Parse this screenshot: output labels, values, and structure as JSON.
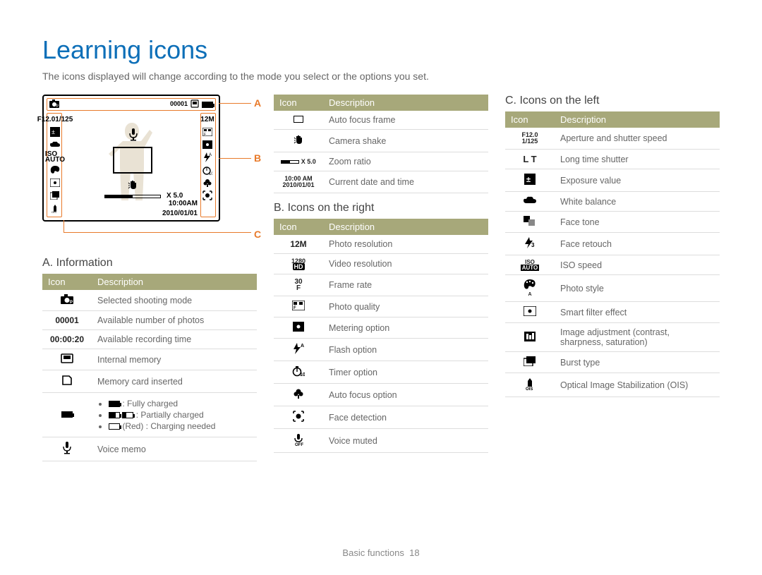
{
  "title": "Learning icons",
  "intro": "The icons displayed will change according to the mode you select or the options you set.",
  "labels": {
    "A": "A",
    "B": "B",
    "C": "C"
  },
  "diagram": {
    "count": "00001",
    "zoom": "X 5.0",
    "time": "10:00AM",
    "date": "2010/01/01",
    "aperture": "F12.0",
    "shutter": "1/125"
  },
  "headers": {
    "icon": "Icon",
    "desc": "Description"
  },
  "sectionA": {
    "title": "A. Information",
    "rows": [
      {
        "icon": "camera",
        "desc": "Selected shooting mode"
      },
      {
        "icon": "00001",
        "desc": "Available number of photos"
      },
      {
        "icon": "00:00:20",
        "desc": "Available recording time"
      },
      {
        "icon": "internal-mem",
        "desc": "Internal memory"
      },
      {
        "icon": "card",
        "desc": "Memory card inserted"
      },
      {
        "icon": "battery",
        "desc_list": [
          ": Fully charged",
          ": Partially charged",
          "(Red) : Charging needed"
        ]
      },
      {
        "icon": "mic",
        "desc": "Voice memo"
      }
    ]
  },
  "sectionTop": {
    "rows": [
      {
        "icon": "frame",
        "desc": "Auto focus frame"
      },
      {
        "icon": "shake",
        "desc": "Camera shake"
      },
      {
        "icon": "zoom",
        "icon_text": "X 5.0",
        "desc": "Zoom ratio"
      },
      {
        "icon": "datetime",
        "icon_text1": "10:00 AM",
        "icon_text2": "2010/01/01",
        "desc": "Current date and time"
      }
    ]
  },
  "sectionB": {
    "title": "B. Icons on the right",
    "rows": [
      {
        "icon": "12M",
        "desc": "Photo resolution"
      },
      {
        "icon": "1280HD",
        "desc": "Video resolution"
      },
      {
        "icon": "30F",
        "desc": "Frame rate"
      },
      {
        "icon": "quality",
        "desc": "Photo quality"
      },
      {
        "icon": "metering",
        "desc": "Metering option"
      },
      {
        "icon": "flashA",
        "desc": "Flash option"
      },
      {
        "icon": "timer10",
        "desc": "Timer option"
      },
      {
        "icon": "flower",
        "desc": "Auto focus option"
      },
      {
        "icon": "facedetect",
        "desc": "Face detection"
      },
      {
        "icon": "micoff",
        "desc": "Voice muted"
      }
    ]
  },
  "sectionC": {
    "title": "C. Icons on the left",
    "rows": [
      {
        "icon": "F12.0 1/125",
        "desc": "Aperture and shutter speed"
      },
      {
        "icon": "LT",
        "desc": "Long time shutter"
      },
      {
        "icon": "ev",
        "desc": "Exposure value"
      },
      {
        "icon": "cloud",
        "desc": "White balance"
      },
      {
        "icon": "facetone",
        "desc": "Face tone"
      },
      {
        "icon": "retouch",
        "desc": "Face retouch"
      },
      {
        "icon": "iso",
        "desc": "ISO speed"
      },
      {
        "icon": "palette",
        "desc": "Photo style"
      },
      {
        "icon": "smartfilter",
        "desc": "Smart filter effect"
      },
      {
        "icon": "adjust",
        "desc": "Image adjustment (contrast, sharpness, saturation)"
      },
      {
        "icon": "burst",
        "desc": "Burst type"
      },
      {
        "icon": "ois",
        "desc": "Optical Image Stabilization (OIS)"
      }
    ]
  },
  "footer": {
    "section": "Basic functions",
    "page": "18"
  }
}
